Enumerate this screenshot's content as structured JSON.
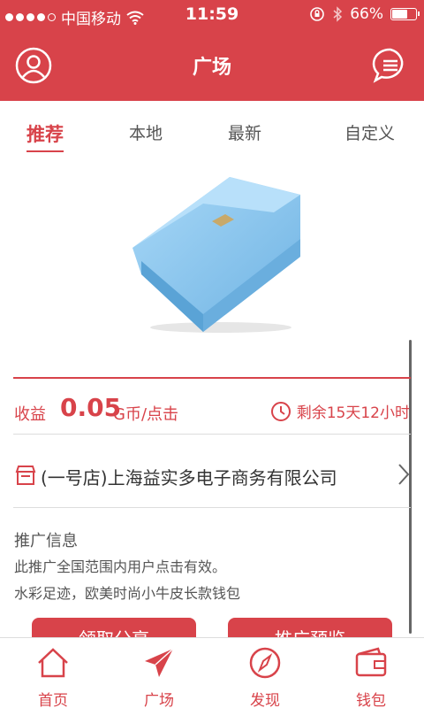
{
  "status_bar": {
    "carrier": "中国移动",
    "time": "11:59",
    "battery": "66%",
    "battery_level": 0.66,
    "signal_bars": 4
  },
  "nav": {
    "title": "广场",
    "left_icon": "user-icon",
    "right_icon": "message-icon"
  },
  "tabs": [
    {
      "label": "推荐",
      "active": true
    },
    {
      "label": "本地",
      "active": false
    },
    {
      "label": "最新",
      "active": false
    },
    {
      "label": "自定义",
      "active": false
    }
  ],
  "product": {
    "image_icon": "wallet-image",
    "color": "#8ec8ee"
  },
  "earnings": {
    "label": "收益",
    "value": "0.05",
    "unit": "G币/点击",
    "remaining": "剩余15天12小时"
  },
  "store": {
    "name": "(一号店)上海益实多电子商务有限公司"
  },
  "promo": {
    "title": "推广信息",
    "line1": "此推广全国范围内用户点击有效。",
    "line2": "水彩足迹，欧美时尚小牛皮长款钱包"
  },
  "actions": {
    "left": "领取分享",
    "right": "推广预览"
  },
  "tabbar": [
    {
      "label": "首页",
      "icon": "home-icon"
    },
    {
      "label": "广场",
      "icon": "paper-plane-icon"
    },
    {
      "label": "发现",
      "icon": "compass-icon"
    },
    {
      "label": "钱包",
      "icon": "wallet-icon"
    }
  ],
  "colors": {
    "accent": "#d8434a"
  }
}
